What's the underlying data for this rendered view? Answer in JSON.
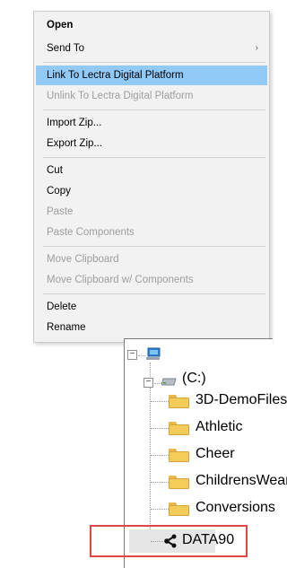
{
  "context_menu": {
    "items": [
      {
        "label": "Open",
        "bold": true,
        "disabled": false
      },
      {
        "label": "Send To",
        "bold": false,
        "disabled": false,
        "submenu_arrow": "›"
      },
      {
        "label": "Link To Lectra Digital Platform",
        "bold": false,
        "disabled": false,
        "highlighted": true
      },
      {
        "label": "Unlink To Lectra Digital Platform",
        "bold": false,
        "disabled": true
      },
      {
        "label": "Import Zip...",
        "bold": false,
        "disabled": false
      },
      {
        "label": "Export Zip...",
        "bold": false,
        "disabled": false
      },
      {
        "label": "Cut",
        "bold": false,
        "disabled": false
      },
      {
        "label": "Copy",
        "bold": false,
        "disabled": false
      },
      {
        "label": "Paste",
        "bold": false,
        "disabled": true
      },
      {
        "label": "Paste Components",
        "bold": false,
        "disabled": true
      },
      {
        "label": "Move Clipboard",
        "bold": false,
        "disabled": true
      },
      {
        "label": "Move Clipboard w/ Components",
        "bold": false,
        "disabled": true
      },
      {
        "label": "Delete",
        "bold": false,
        "disabled": false
      },
      {
        "label": "Rename",
        "bold": false,
        "disabled": false
      }
    ]
  },
  "tree": {
    "expand_glyph": "−",
    "drive_label": "(C:)",
    "folders": [
      "3D-DemoFiles",
      "Athletic",
      "Cheer",
      "ChildrensWear",
      "Conversions"
    ],
    "shared_item": "DATA90",
    "highlight_color": "#e04646"
  }
}
